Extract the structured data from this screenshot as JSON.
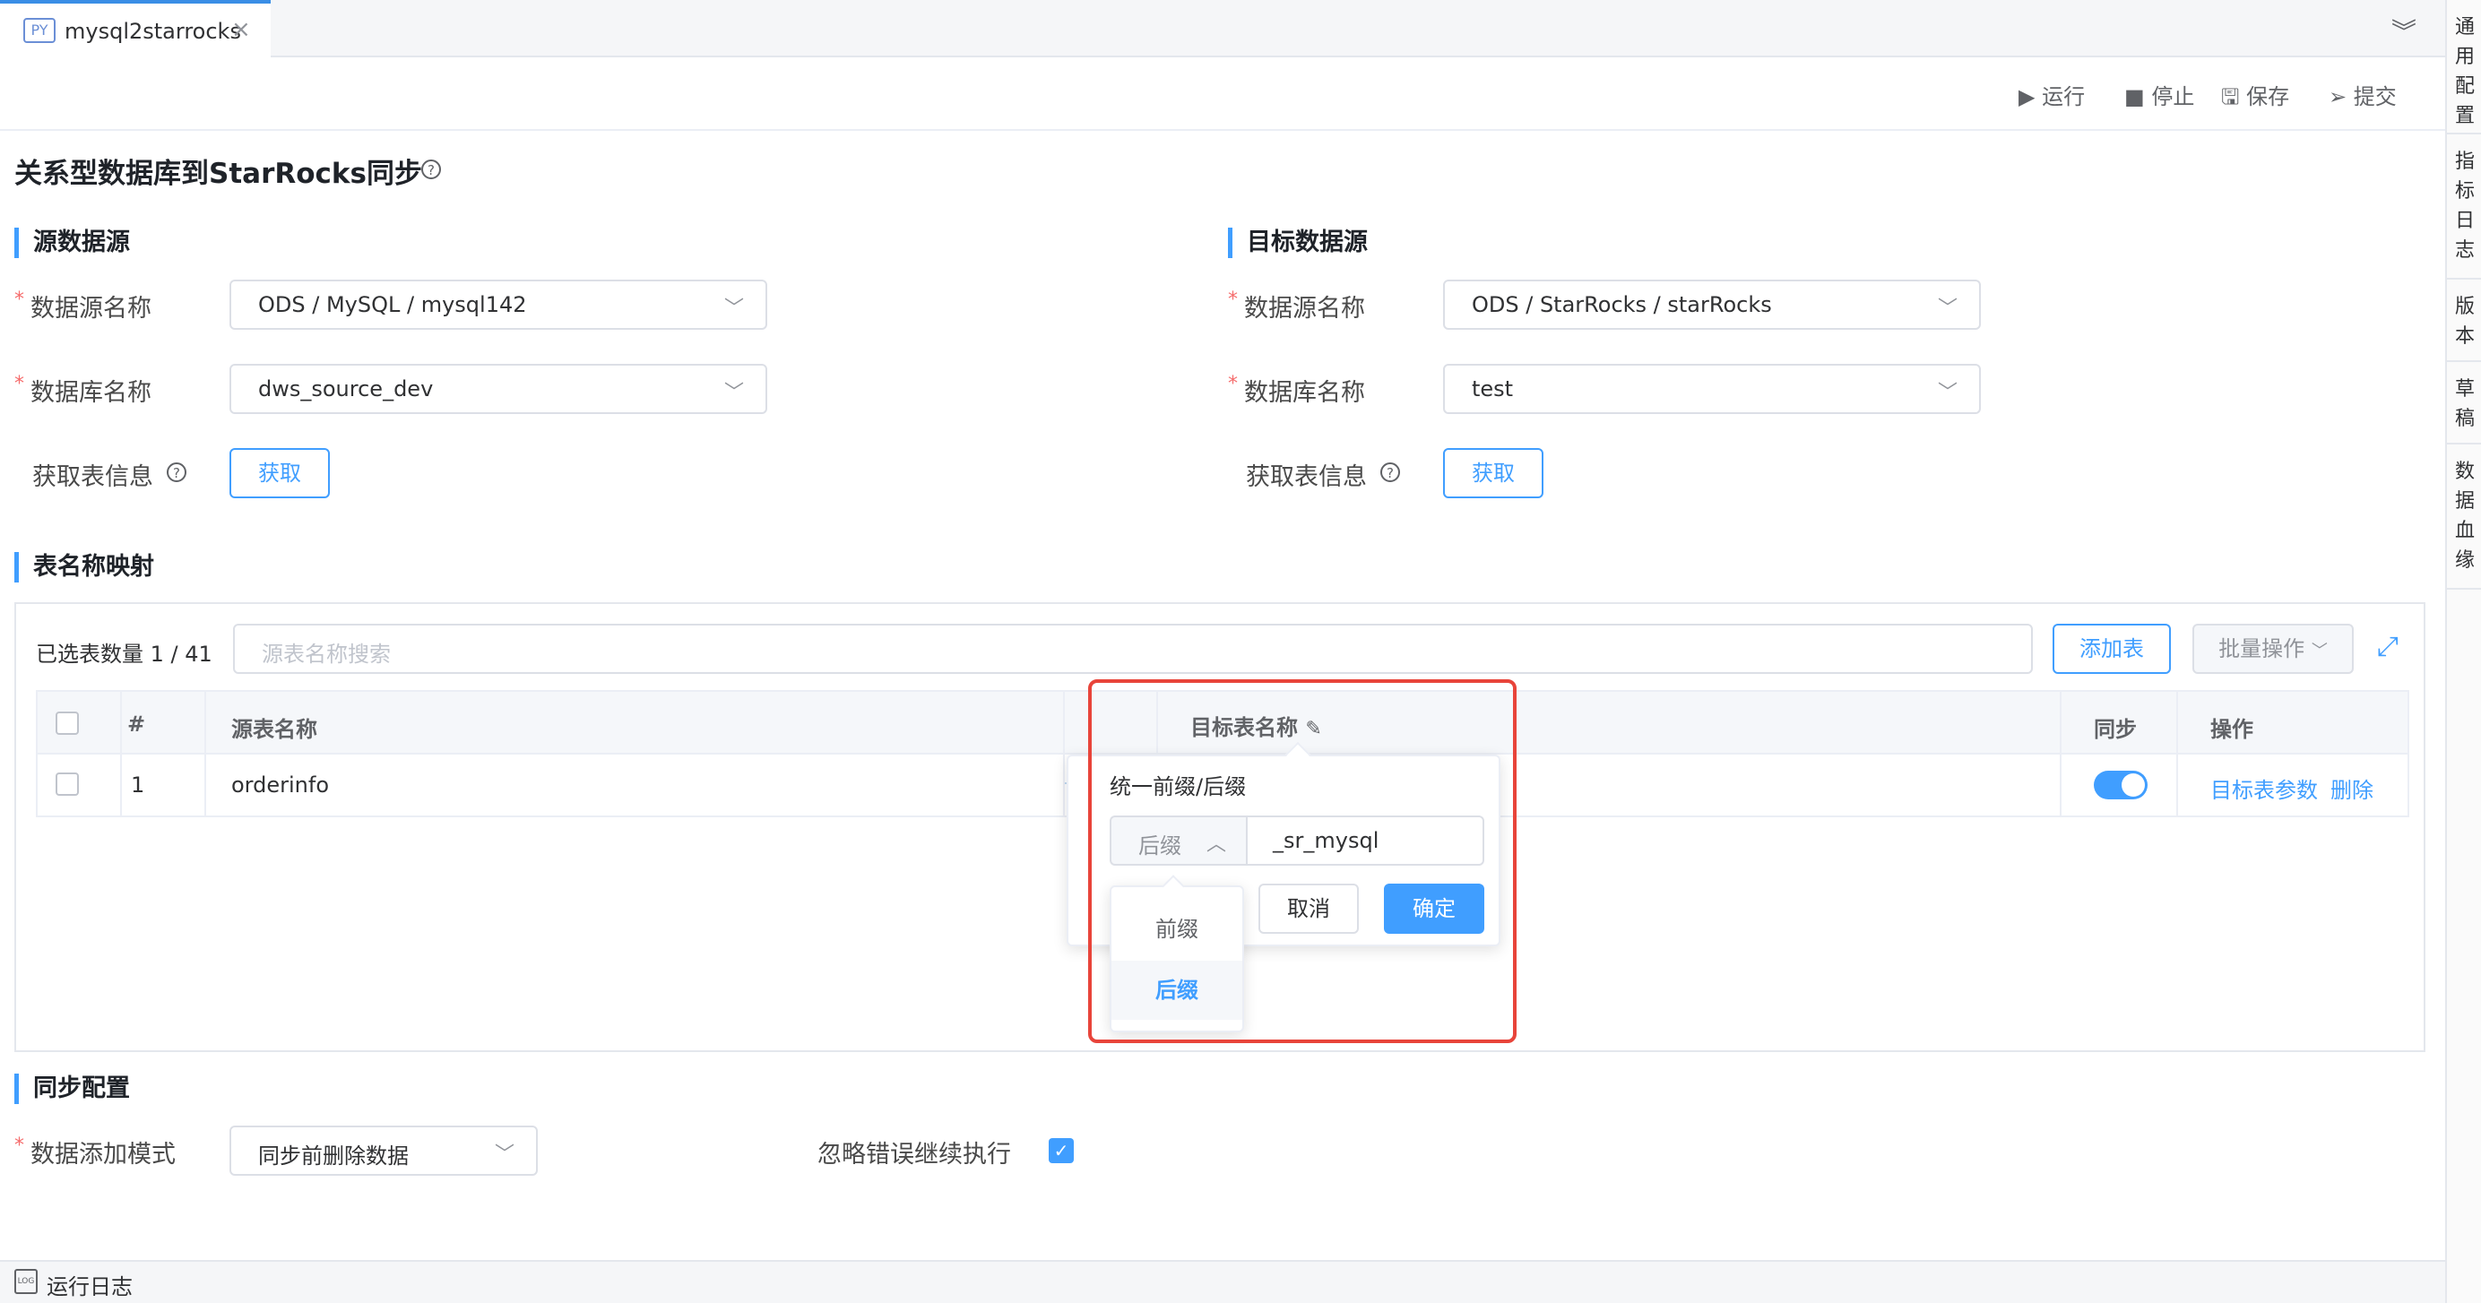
{
  "tab": {
    "title": "mysql2starrocks",
    "icon": "PY"
  },
  "rail": [
    "通用配置",
    "指标日志",
    "版本",
    "草稿",
    "数据血缘"
  ],
  "toolbar": {
    "run": "运行",
    "stop": "停止",
    "save": "保存",
    "submit": "提交"
  },
  "page_title": "关系型数据库到StarRocks同步",
  "source": {
    "heading": "源数据源",
    "ds_label": "数据源名称",
    "ds_value": "ODS / MySQL / mysql142",
    "db_label": "数据库名称",
    "db_value": "dws_source_dev",
    "fetch_label": "获取表信息",
    "fetch_btn": "获取"
  },
  "target": {
    "heading": "目标数据源",
    "ds_label": "数据源名称",
    "ds_value": "ODS / StarRocks / starRocks",
    "db_label": "数据库名称",
    "db_value": "test",
    "fetch_label": "获取表信息",
    "fetch_btn": "获取"
  },
  "mapping": {
    "heading": "表名称映射",
    "selected_count": "已选表数量 1 / 41",
    "search_placeholder": "源表名称搜索",
    "add_btn": "添加表",
    "batch_btn": "批量操作",
    "columns": {
      "index": "#",
      "source": "源表名称",
      "target": "目标表名称",
      "sync": "同步",
      "ops": "操作"
    },
    "rows": [
      {
        "index": "1",
        "source": "orderinfo",
        "sync": true,
        "op_params": "目标表参数",
        "op_delete": "删除"
      }
    ]
  },
  "popover": {
    "title": "统一前缀/后缀",
    "mode_value": "后缀",
    "suffix_value": "_sr_mysql",
    "cancel": "取消",
    "ok": "确定",
    "options": [
      "前缀",
      "后缀"
    ],
    "selected_option": "后缀"
  },
  "sync_config": {
    "heading": "同步配置",
    "mode_label": "数据添加模式",
    "mode_value": "同步前删除数据",
    "ignore_label": "忽略错误继续执行",
    "ignore_checked": true
  },
  "bottom": {
    "log_label": "运行日志",
    "log_icon": "LOG"
  },
  "colors": {
    "accent": "#409eff",
    "highlight": "#e8443a",
    "required": "#f56c6c"
  }
}
